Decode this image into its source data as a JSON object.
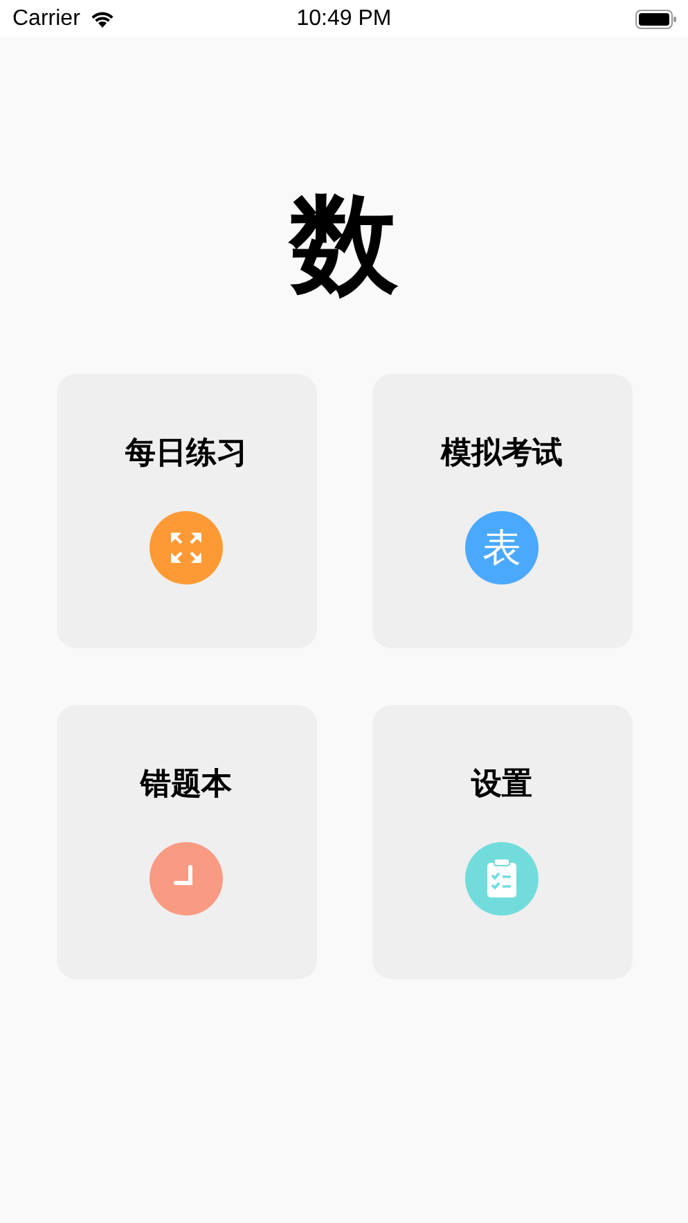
{
  "status_bar": {
    "carrier": "Carrier",
    "time": "10:49 PM"
  },
  "title": "数",
  "cards": [
    {
      "label": "每日练习",
      "kind": "expand",
      "color": "#fe9a35"
    },
    {
      "label": "模拟考试",
      "kind": "glyph",
      "glyph": "表",
      "color": "#4aa9fc"
    },
    {
      "label": "错题本",
      "kind": "clock",
      "color": "#f99a83"
    },
    {
      "label": "设置",
      "kind": "clipboard",
      "color": "#72dcdc"
    }
  ]
}
